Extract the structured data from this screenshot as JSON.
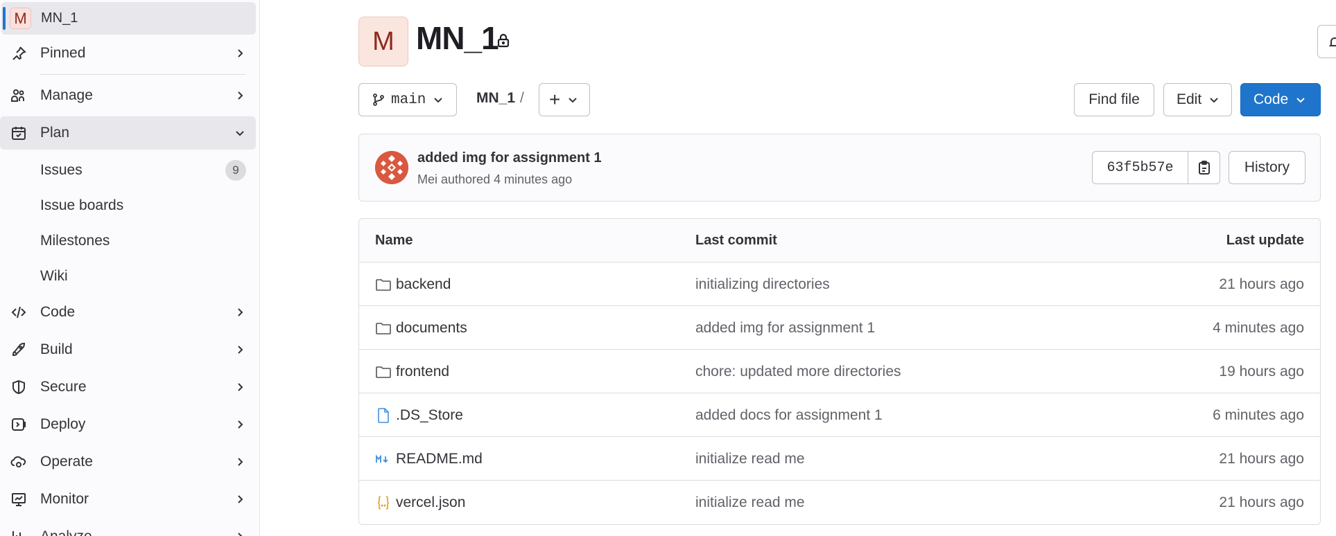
{
  "sidebar": {
    "project": {
      "avatar_letter": "M",
      "name": "MN_1"
    },
    "pinned_label": "Pinned",
    "items": [
      {
        "label": "Manage",
        "icon": "users-icon"
      },
      {
        "label": "Plan",
        "icon": "planning-icon",
        "expanded": true
      },
      {
        "label": "Code",
        "icon": "code-icon"
      },
      {
        "label": "Build",
        "icon": "rocket-icon"
      },
      {
        "label": "Secure",
        "icon": "shield-icon"
      },
      {
        "label": "Deploy",
        "icon": "deploy-icon"
      },
      {
        "label": "Operate",
        "icon": "cloud-gear-icon"
      },
      {
        "label": "Monitor",
        "icon": "monitor-icon"
      },
      {
        "label": "Analyze",
        "icon": "chart-icon"
      }
    ],
    "plan_subitems": [
      {
        "label": "Issues",
        "badge": "9"
      },
      {
        "label": "Issue boards"
      },
      {
        "label": "Milestones"
      },
      {
        "label": "Wiki"
      }
    ]
  },
  "header": {
    "avatar_letter": "M",
    "title": "MN_1"
  },
  "toolbar": {
    "branch": "main",
    "breadcrumb": "MN_1",
    "breadcrumb_sep": "/",
    "add_label": "+",
    "find_file": "Find file",
    "edit": "Edit",
    "code": "Code"
  },
  "commit": {
    "title": "added img for assignment 1",
    "meta": "Mei authored 4 minutes ago",
    "sha": "63f5b57e",
    "history": "History"
  },
  "files": {
    "columns": [
      "Name",
      "Last commit",
      "Last update"
    ],
    "rows": [
      {
        "name": "backend",
        "type": "folder",
        "commit": "initializing directories",
        "updated": "21 hours ago"
      },
      {
        "name": "documents",
        "type": "folder",
        "commit": "added img for assignment 1",
        "updated": "4 minutes ago"
      },
      {
        "name": "frontend",
        "type": "folder",
        "commit": "chore: updated more directories",
        "updated": "19 hours ago"
      },
      {
        "name": ".DS_Store",
        "type": "file",
        "commit": "added docs for assignment 1",
        "updated": "6 minutes ago"
      },
      {
        "name": "README.md",
        "type": "markdown",
        "commit": "initialize read me",
        "updated": "21 hours ago"
      },
      {
        "name": "vercel.json",
        "type": "json",
        "commit": "initialize read me",
        "updated": "21 hours ago"
      }
    ]
  },
  "colors": {
    "accent": "#1f75cb",
    "avatar_bg": "#fbe5df",
    "avatar_fg": "#8e2a1c"
  }
}
